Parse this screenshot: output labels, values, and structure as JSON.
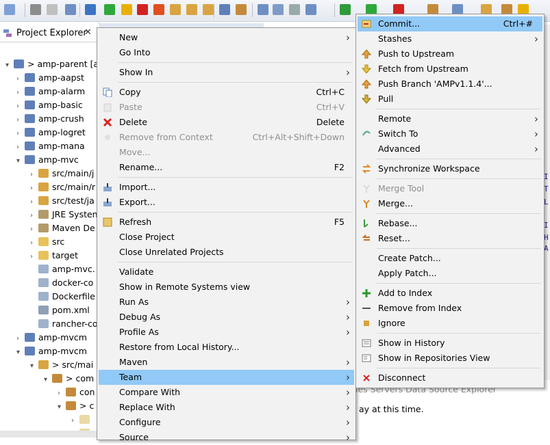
{
  "explorer": {
    "title": "Project Explorer",
    "close_glyph": "✕",
    "tree": [
      {
        "label": "> amp-parent  [a",
        "twisty": "▾",
        "icon": "project-icon"
      },
      {
        "label": "amp-aapst",
        "twisty": "›",
        "icon": "project-icon"
      },
      {
        "label": "amp-alarm",
        "twisty": "›",
        "icon": "project-icon"
      },
      {
        "label": "amp-basic",
        "twisty": "›",
        "icon": "project-icon"
      },
      {
        "label": "amp-crush",
        "twisty": "›",
        "icon": "project-icon"
      },
      {
        "label": "amp-logret",
        "twisty": "›",
        "icon": "project-icon"
      },
      {
        "label": "amp-mana",
        "twisty": "›",
        "icon": "project-icon"
      },
      {
        "label": "amp-mvc",
        "twisty": "▾",
        "icon": "project-icon"
      },
      {
        "label": "src/main/j",
        "twisty": "›",
        "icon": "source-folder-icon"
      },
      {
        "label": "src/main/r",
        "twisty": "›",
        "icon": "source-folder-icon"
      },
      {
        "label": "src/test/ja",
        "twisty": "›",
        "icon": "source-folder-icon"
      },
      {
        "label": "JRE Systen",
        "twisty": "›",
        "icon": "library-icon"
      },
      {
        "label": "Maven De",
        "twisty": "›",
        "icon": "library-icon"
      },
      {
        "label": "src",
        "twisty": "›",
        "icon": "folder-icon"
      },
      {
        "label": "target",
        "twisty": "›",
        "icon": "folder-icon"
      },
      {
        "label": "amp-mvc.",
        "twisty": "",
        "icon": "file-icon"
      },
      {
        "label": "docker-co",
        "twisty": "",
        "icon": "file-icon"
      },
      {
        "label": "Dockerfile",
        "twisty": "",
        "icon": "file-icon"
      },
      {
        "label": "pom.xml",
        "twisty": "",
        "icon": "xml-file-icon"
      },
      {
        "label": "rancher-co",
        "twisty": "",
        "icon": "file-icon"
      },
      {
        "label": "amp-mvcm",
        "twisty": "›",
        "icon": "project-icon"
      },
      {
        "label": "amp-mvcm",
        "twisty": "▾",
        "icon": "project-icon"
      },
      {
        "label": "> src/mai",
        "twisty": "▾",
        "icon": "source-folder-icon"
      },
      {
        "label": "> com",
        "twisty": "▾",
        "icon": "package-icon"
      },
      {
        "label": "con",
        "twisty": "›",
        "icon": "package-icon"
      },
      {
        "label": "> c",
        "twisty": "▾",
        "icon": "package-icon"
      },
      {
        "label": "",
        "twisty": "›",
        "icon": "java-file-icon"
      },
      {
        "label": "",
        "twisty": "›",
        "icon": "java-file-icon"
      }
    ]
  },
  "context_menu": {
    "items": [
      {
        "label": "New",
        "accel": "",
        "submenu": true,
        "disabled": false,
        "icon": ""
      },
      {
        "label": "Go Into",
        "accel": "",
        "submenu": false,
        "disabled": false,
        "icon": ""
      },
      {
        "sep": true
      },
      {
        "label": "Show In",
        "accel": "",
        "submenu": true,
        "disabled": false,
        "icon": ""
      },
      {
        "sep": true
      },
      {
        "label": "Copy",
        "accel": "Ctrl+C",
        "submenu": false,
        "disabled": false,
        "icon": "copy-icon"
      },
      {
        "label": "Paste",
        "accel": "Ctrl+V",
        "submenu": false,
        "disabled": true,
        "icon": "paste-icon"
      },
      {
        "label": "Delete",
        "accel": "Delete",
        "submenu": false,
        "disabled": false,
        "icon": "delete-icon"
      },
      {
        "label": "Remove from Context",
        "accel": "Ctrl+Alt+Shift+Down",
        "submenu": false,
        "disabled": true,
        "icon": "remove-context-icon"
      },
      {
        "label": "Move...",
        "accel": "",
        "submenu": false,
        "disabled": true,
        "icon": ""
      },
      {
        "label": "Rename...",
        "accel": "F2",
        "submenu": false,
        "disabled": false,
        "icon": ""
      },
      {
        "sep": true
      },
      {
        "label": "Import...",
        "accel": "",
        "submenu": false,
        "disabled": false,
        "icon": "import-icon"
      },
      {
        "label": "Export...",
        "accel": "",
        "submenu": false,
        "disabled": false,
        "icon": "export-icon"
      },
      {
        "sep": true
      },
      {
        "label": "Refresh",
        "accel": "F5",
        "submenu": false,
        "disabled": false,
        "icon": "refresh-icon"
      },
      {
        "label": "Close Project",
        "accel": "",
        "submenu": false,
        "disabled": false,
        "icon": ""
      },
      {
        "label": "Close Unrelated Projects",
        "accel": "",
        "submenu": false,
        "disabled": false,
        "icon": ""
      },
      {
        "sep": true
      },
      {
        "label": "Validate",
        "accel": "",
        "submenu": false,
        "disabled": false,
        "icon": ""
      },
      {
        "label": "Show in Remote Systems view",
        "accel": "",
        "submenu": false,
        "disabled": false,
        "icon": ""
      },
      {
        "label": "Run As",
        "accel": "",
        "submenu": true,
        "disabled": false,
        "icon": ""
      },
      {
        "label": "Debug As",
        "accel": "",
        "submenu": true,
        "disabled": false,
        "icon": ""
      },
      {
        "label": "Profile As",
        "accel": "",
        "submenu": true,
        "disabled": false,
        "icon": ""
      },
      {
        "label": "Restore from Local History...",
        "accel": "",
        "submenu": false,
        "disabled": false,
        "icon": ""
      },
      {
        "label": "Maven",
        "accel": "",
        "submenu": true,
        "disabled": false,
        "icon": ""
      },
      {
        "label": "Team",
        "accel": "",
        "submenu": true,
        "disabled": false,
        "icon": "",
        "highlighted": true
      },
      {
        "label": "Compare With",
        "accel": "",
        "submenu": true,
        "disabled": false,
        "icon": ""
      },
      {
        "label": "Replace With",
        "accel": "",
        "submenu": true,
        "disabled": false,
        "icon": ""
      },
      {
        "label": "Configure",
        "accel": "",
        "submenu": true,
        "disabled": false,
        "icon": ""
      },
      {
        "label": "Source",
        "accel": "",
        "submenu": true,
        "disabled": false,
        "icon": ""
      }
    ]
  },
  "team_menu": {
    "items": [
      {
        "label": "Commit...",
        "accel": "Ctrl+#",
        "submenu": false,
        "disabled": false,
        "icon": "commit-icon",
        "highlighted": true
      },
      {
        "label": "Stashes",
        "accel": "",
        "submenu": true,
        "disabled": false,
        "icon": ""
      },
      {
        "label": "Push to Upstream",
        "accel": "",
        "submenu": false,
        "disabled": false,
        "icon": "push-icon"
      },
      {
        "label": "Fetch from Upstream",
        "accel": "",
        "submenu": false,
        "disabled": false,
        "icon": "fetch-icon"
      },
      {
        "label": "Push Branch 'AMPv1.1.4'...",
        "accel": "",
        "submenu": false,
        "disabled": false,
        "icon": "push-branch-icon"
      },
      {
        "label": "Pull",
        "accel": "",
        "submenu": false,
        "disabled": false,
        "icon": "pull-icon"
      },
      {
        "sep": true
      },
      {
        "label": "Remote",
        "accel": "",
        "submenu": true,
        "disabled": false,
        "icon": ""
      },
      {
        "label": "Switch To",
        "accel": "",
        "submenu": true,
        "disabled": false,
        "icon": "switch-icon"
      },
      {
        "label": "Advanced",
        "accel": "",
        "submenu": true,
        "disabled": false,
        "icon": ""
      },
      {
        "sep": true
      },
      {
        "label": "Synchronize Workspace",
        "accel": "",
        "submenu": false,
        "disabled": false,
        "icon": "synchronize-icon"
      },
      {
        "sep": true
      },
      {
        "label": "Merge Tool",
        "accel": "",
        "submenu": false,
        "disabled": true,
        "icon": "merge-tool-icon"
      },
      {
        "label": "Merge...",
        "accel": "",
        "submenu": false,
        "disabled": false,
        "icon": "merge-icon"
      },
      {
        "sep": true
      },
      {
        "label": "Rebase...",
        "accel": "",
        "submenu": false,
        "disabled": false,
        "icon": "rebase-icon"
      },
      {
        "label": "Reset...",
        "accel": "",
        "submenu": false,
        "disabled": false,
        "icon": "reset-icon"
      },
      {
        "sep": true
      },
      {
        "label": "Create Patch...",
        "accel": "",
        "submenu": false,
        "disabled": false,
        "icon": ""
      },
      {
        "label": "Apply Patch...",
        "accel": "",
        "submenu": false,
        "disabled": false,
        "icon": ""
      },
      {
        "sep": true
      },
      {
        "label": "Add to Index",
        "accel": "",
        "submenu": false,
        "disabled": false,
        "icon": "add-index-icon"
      },
      {
        "label": "Remove from Index",
        "accel": "",
        "submenu": false,
        "disabled": false,
        "icon": "remove-index-icon"
      },
      {
        "label": "Ignore",
        "accel": "",
        "submenu": false,
        "disabled": false,
        "icon": "ignore-icon"
      },
      {
        "sep": true
      },
      {
        "label": "Show in History",
        "accel": "",
        "submenu": false,
        "disabled": false,
        "icon": "history-icon"
      },
      {
        "label": "Show in Repositories View",
        "accel": "",
        "submenu": false,
        "disabled": false,
        "icon": "repositories-icon"
      },
      {
        "sep": true
      },
      {
        "label": "Disconnect",
        "accel": "",
        "submenu": false,
        "disabled": false,
        "icon": "disconnect-icon"
      }
    ]
  },
  "background": {
    "bottom_views": "ies  Servers  Data Source Explorer",
    "bottom_message": "ay at this time.",
    "code_fragments": [
      "I",
      "T",
      "L",
      "I",
      "H",
      "A"
    ]
  },
  "colors": {
    "menu_bg": "#f2f2f2",
    "highlight": "#91c9f7",
    "disabled_text": "#8f8f8f",
    "separator": "#d7d7d7"
  }
}
